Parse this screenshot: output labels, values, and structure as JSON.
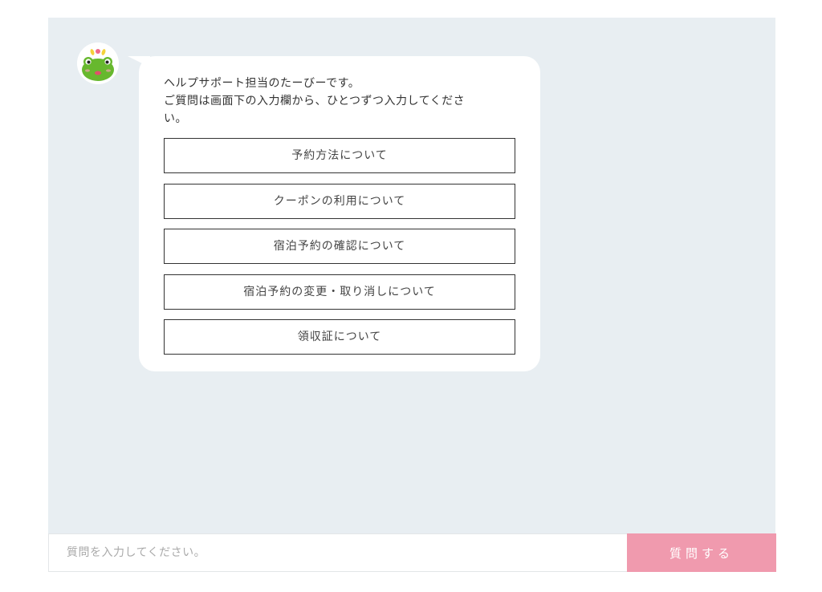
{
  "chat": {
    "bot_icon": "frog-mascot-icon",
    "message": {
      "line1": "ヘルプサポート担当のたーびーです。",
      "line2": "ご質問は画面下の入力欄から、ひとつずつ入力してくださ",
      "line3": "い。"
    },
    "options": [
      "予約方法について",
      "クーポンの利用について",
      "宿泊予約の確認について",
      "宿泊予約の変更・取り消しについて",
      "領収証について"
    ]
  },
  "input": {
    "placeholder": "質問を入力してください。",
    "value": ""
  },
  "submit": {
    "label": "質問する"
  },
  "colors": {
    "chat_background": "#e8eef2",
    "submit_button": "#f09aae",
    "bubble": "#ffffff"
  }
}
